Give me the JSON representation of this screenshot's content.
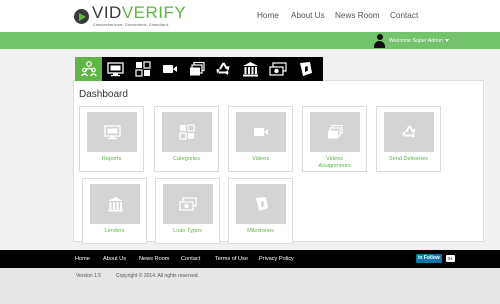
{
  "brand": {
    "name_part1": "VID",
    "name_part2": "VERIFY",
    "tagline": "Comprehensive. Convenient. Compliant."
  },
  "topnav": {
    "items": [
      "Home",
      "About Us",
      "News Room",
      "Contact"
    ]
  },
  "user": {
    "greeting": "Welcome Super Admin"
  },
  "iconbar": {
    "tabs": [
      {
        "icon": "users-icon",
        "active": true
      },
      {
        "icon": "reports-icon",
        "active": false
      },
      {
        "icon": "categories-icon",
        "active": false
      },
      {
        "icon": "video-camera-icon",
        "active": false
      },
      {
        "icon": "video-assignments-icon",
        "active": false
      },
      {
        "icon": "recycle-icon",
        "active": false
      },
      {
        "icon": "bank-icon",
        "active": false
      },
      {
        "icon": "money-icon",
        "active": false
      },
      {
        "icon": "milestones-icon",
        "active": false
      }
    ]
  },
  "dashboard": {
    "title": "Dashboard",
    "tiles": [
      {
        "label": "Reports",
        "icon": "reports-icon"
      },
      {
        "label": "Categories",
        "icon": "categories-icon"
      },
      {
        "label": "Videos",
        "icon": "video-camera-icon"
      },
      {
        "label": "Videos Assignments",
        "icon": "video-assignments-icon"
      },
      {
        "label": "Send Deliveries",
        "icon": "recycle-icon"
      },
      {
        "label": "Lenders",
        "icon": "bank-icon"
      },
      {
        "label": "Loan Types",
        "icon": "money-icon"
      },
      {
        "label": "Milestones",
        "icon": "milestones-icon"
      }
    ]
  },
  "footer": {
    "nav": [
      "Home",
      "About Us",
      "News Room",
      "Contact",
      "Terms of Use",
      "Privacy Policy"
    ],
    "linkedin_label": "in Follow",
    "linkedin_count": "34",
    "version": "Version 1.5",
    "copyright": "Copyright © 2014. All rights reserved."
  },
  "colors": {
    "accent": "#61b446",
    "greenbar": "#73c36b",
    "dark": "#000000",
    "tile_thumb": "#d4d4d4"
  }
}
